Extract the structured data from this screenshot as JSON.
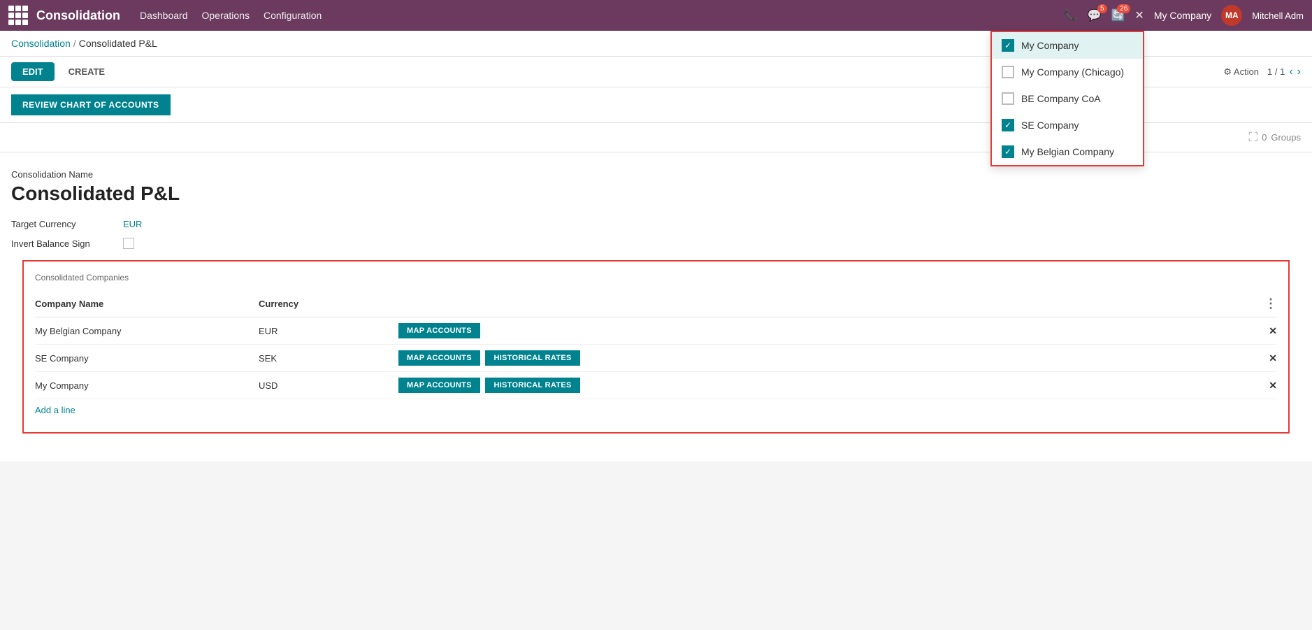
{
  "app": {
    "brand": "Consolidation",
    "nav_items": [
      "Dashboard",
      "Operations",
      "Configuration"
    ],
    "notifications_count": "5",
    "updates_count": "26",
    "company": "My Company",
    "username": "Mitchell Adm",
    "avatar_initials": "MA"
  },
  "breadcrumb": {
    "parent": "Consolidation",
    "separator": "/",
    "current": "Consolidated P&L"
  },
  "toolbar": {
    "edit_label": "EDIT",
    "create_label": "CREATE",
    "action_label": "⚙ Action",
    "pagination": "1 / 1"
  },
  "review_chart": {
    "button_label": "REVIEW CHART OF ACCOUNTS"
  },
  "filter_bar": {
    "groups_count": "0",
    "groups_label": "Groups"
  },
  "form": {
    "consolidation_name_label": "Consolidation Name",
    "consolidation_name_value": "Consolidated P&L",
    "target_currency_label": "Target Currency",
    "target_currency_value": "EUR",
    "invert_balance_label": "Invert Balance Sign"
  },
  "companies_section": {
    "title": "Consolidated Companies",
    "col_company": "Company Name",
    "col_currency": "Currency",
    "rows": [
      {
        "company": "My Belgian Company",
        "currency": "EUR",
        "map_accounts": "MAP ACCOUNTS",
        "historical_rates": null
      },
      {
        "company": "SE Company",
        "currency": "SEK",
        "map_accounts": "MAP ACCOUNTS",
        "historical_rates": "HISTORICAL RATES"
      },
      {
        "company": "My Company",
        "currency": "USD",
        "map_accounts": "MAP ACCOUNTS",
        "historical_rates": "HISTORICAL RATES"
      }
    ],
    "add_line": "Add a line"
  },
  "dropdown": {
    "items": [
      {
        "label": "My Company",
        "checked": true,
        "selected": true
      },
      {
        "label": "My Company (Chicago)",
        "checked": false,
        "selected": false
      },
      {
        "label": "BE Company CoA",
        "checked": false,
        "selected": false
      },
      {
        "label": "SE Company",
        "checked": true,
        "selected": false
      },
      {
        "label": "My Belgian Company",
        "checked": true,
        "selected": false
      }
    ]
  }
}
